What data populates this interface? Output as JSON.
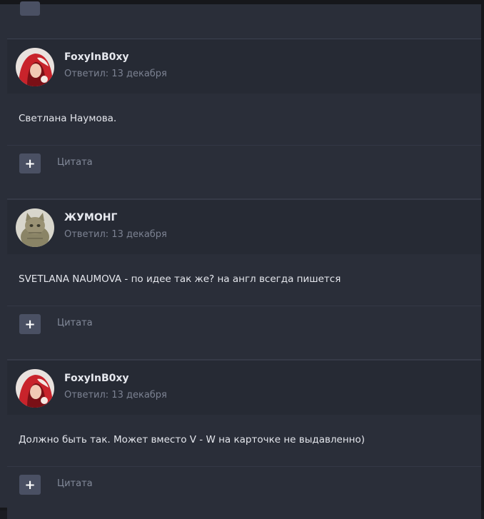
{
  "posts": [
    {
      "author": "FoxyInB0xy",
      "meta": "Ответил: 13 декабря",
      "text": "Светлана Наумова.",
      "quote_label": "Цитата",
      "avatar": "avatar-red-hood"
    },
    {
      "author": "ЖУМОНГ",
      "meta": "Ответил: 13 декабря",
      "text": "SVETLANA NAUMOVA - по идее так же? на англ всегда пишется",
      "quote_label": "Цитата",
      "avatar": "avatar-cat"
    },
    {
      "author": "FoxyInB0xy",
      "meta": "Ответил: 13 декабря",
      "text": "Должно быть так. Может вместо V - W на карточке не выдавленно)",
      "quote_label": "Цитата",
      "avatar": "avatar-red-hood"
    }
  ],
  "colors": {
    "background": "#2a2e39",
    "header_background": "#262a34",
    "button": "#4a5063",
    "author_text": "#e6e8ee",
    "meta_text": "#7c8292"
  }
}
